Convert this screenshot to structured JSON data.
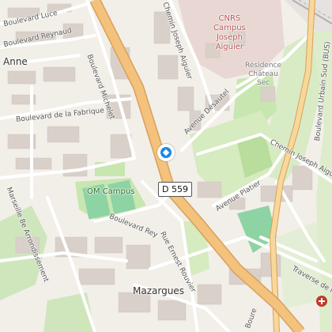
{
  "map": {
    "colors": {
      "land": "#f2efe9",
      "building": "#d9d0c9",
      "park": "#c8e6b0",
      "sport": "#8ed3a4",
      "campus": "#e8d7d2",
      "primary_road": "#f3c27c",
      "primary_road_edge": "#d9a05b",
      "railway": "#b0b0b0"
    },
    "labels": {
      "boulevard_luce": "Boulevard Luce",
      "boulevard_reynaud": "Boulevard Reynaud",
      "anne": "Anne",
      "boulevard_michelet": "Boulevard Michelet",
      "boulevard_de_la_fabrique": "Boulevard de la Fabrique",
      "chemin_joseph_aiguier_top": "Chemin Joseph Aiguier",
      "cnrs_campus": "CNRS\nCampus\nJoseph\nAiguier",
      "residence_chateau_sec": "Résidence\nChâteau\nSec",
      "boulevard_urbain_sud": "Boulevard Urbain Sud (BUS)",
      "avenue_desautel": "Avenue Désautel",
      "chemin_joseph_aiguier_right": "Chemin Joseph Aiguier",
      "d559": "D 559",
      "om_campus": "OM Campus",
      "avenue_platier": "Avenue Platier",
      "boulevard_rey": "Boulevard Rey",
      "marseille_arrondissement": "Marseille 8e Arrondissement",
      "rue_ernest_rouvier": "Rue Ernest Rouvier",
      "traverse_de_la": "Traverse de la",
      "mazargues": "Mazargues",
      "boure": "Boure"
    },
    "icons": {
      "direction_marker": "directions-marker-icon",
      "hospital": "hospital-icon"
    }
  }
}
